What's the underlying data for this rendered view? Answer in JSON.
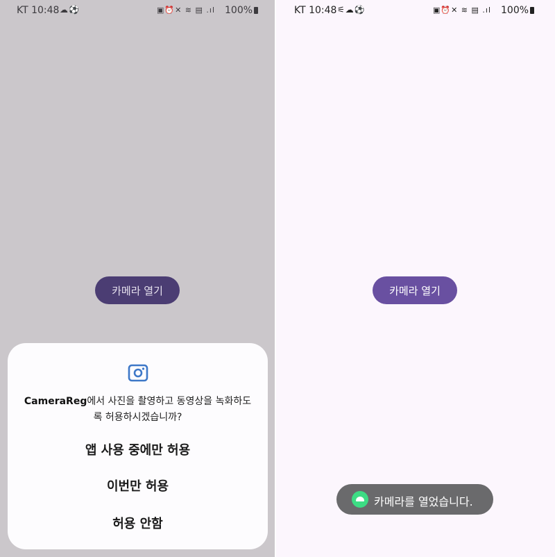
{
  "left": {
    "status": {
      "carrier": "KT 10:48",
      "left_icons": "☁⚽",
      "right_icons": "▣⏰✕ ≋ ▤ .ıl",
      "battery": "100%"
    },
    "open_camera_label": "카메라 열기",
    "dialog": {
      "app_name": "CameraReg",
      "message": "에서 사진을 촬영하고 동영상을 녹화하도록 허용하시겠습니까?",
      "options": [
        "앱 사용 중에만 허용",
        "이번만 허용",
        "허용 안함"
      ]
    }
  },
  "right": {
    "status": {
      "carrier": "KT 10:48",
      "left_icons": "⚟☁⚽",
      "right_icons": "▣⏰✕ ≋ ▤ .ıl",
      "battery": "100%"
    },
    "open_camera_label": "카메라 열기",
    "toast": "카메라를 열었습니다."
  },
  "colors": {
    "left_bg": "#cbc7cb",
    "right_bg": "#fcf6fd",
    "button_left": "#4b3d73",
    "button_right": "#6950a1",
    "toast_bg": "#6a6a6c",
    "camera_icon": "#3e78c8"
  }
}
